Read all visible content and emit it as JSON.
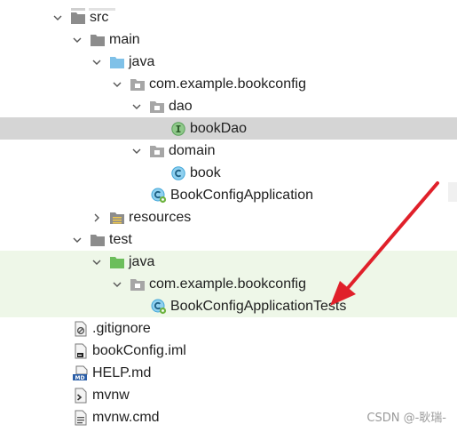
{
  "tree": {
    "items": [
      {
        "label": "src",
        "icon": "folder-icon",
        "expanded": true
      },
      {
        "label": "main",
        "icon": "folder-icon",
        "expanded": true
      },
      {
        "label": "java",
        "icon": "source-folder-icon",
        "expanded": true
      },
      {
        "label": "com.example.bookconfig",
        "icon": "package-icon",
        "expanded": true
      },
      {
        "label": "dao",
        "icon": "package-icon",
        "expanded": true
      },
      {
        "label": "bookDao",
        "icon": "interface-icon",
        "selected": true
      },
      {
        "label": "domain",
        "icon": "package-icon",
        "expanded": true
      },
      {
        "label": "book",
        "icon": "class-icon"
      },
      {
        "label": "BookConfigApplication",
        "icon": "spring-boot-class-icon"
      },
      {
        "label": "resources",
        "icon": "resources-folder-icon",
        "expanded": false
      },
      {
        "label": "test",
        "icon": "folder-icon",
        "expanded": true
      },
      {
        "label": "java",
        "icon": "test-source-folder-icon",
        "expanded": true
      },
      {
        "label": "com.example.bookconfig",
        "icon": "package-icon",
        "expanded": true
      },
      {
        "label": "BookConfigApplicationTests",
        "icon": "spring-boot-class-icon"
      },
      {
        "label": ".gitignore",
        "icon": "gitignore-icon"
      },
      {
        "label": "bookConfig.iml",
        "icon": "iml-file-icon"
      },
      {
        "label": "HELP.md",
        "icon": "markdown-icon"
      },
      {
        "label": "mvnw",
        "icon": "script-icon"
      },
      {
        "label": "mvnw.cmd",
        "icon": "text-file-icon"
      }
    ]
  },
  "annotation": {
    "color": "#e0202a"
  },
  "watermark": "CSDN @-耿瑞-",
  "colors": {
    "selected_row": "#d5d5d5",
    "test_highlight": "#eef7e8",
    "folder_gray": "#8c8c8c",
    "source_blue": "#7fc1e8",
    "test_green": "#6cbe5b",
    "class_cyan": "#41a6d9",
    "interface_green": "#5aa05a"
  }
}
